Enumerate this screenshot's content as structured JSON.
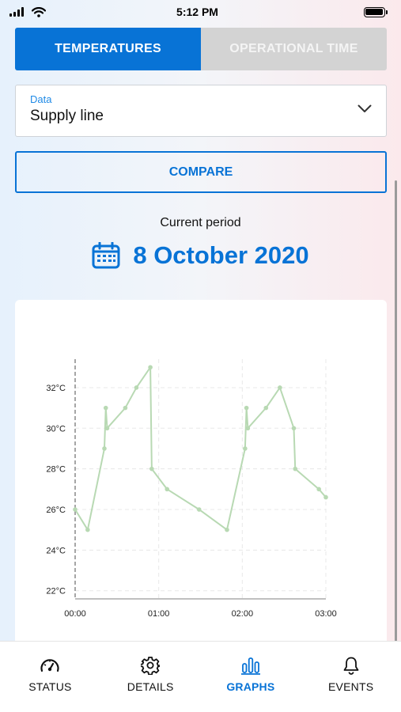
{
  "status_bar": {
    "time": "5:12 PM"
  },
  "tabs": [
    {
      "label": "TEMPERATURES",
      "active": true
    },
    {
      "label": "OPERATIONAL TIME",
      "active": false
    }
  ],
  "data_select": {
    "label": "Data",
    "value": "Supply line"
  },
  "compare_button": {
    "label": "COMPARE"
  },
  "period": {
    "label": "Current period",
    "date": "8 October 2020"
  },
  "chart_data": {
    "type": "line",
    "title": "",
    "xlabel": "",
    "ylabel": "",
    "x_ticks": [
      "00:00",
      "01:00",
      "02:00",
      "03:00"
    ],
    "y_ticks": [
      "22°C",
      "24°C",
      "26°C",
      "28°C",
      "30°C",
      "32°C"
    ],
    "xlim": [
      "00:00",
      "03:00"
    ],
    "ylim": [
      21.6,
      33.4
    ],
    "grid": true,
    "color": "#b8d9b3",
    "series": [
      {
        "values": [
          {
            "x": "00:00",
            "y": 26
          },
          {
            "x": "00:09",
            "y": 25
          },
          {
            "x": "00:21",
            "y": 29
          },
          {
            "x": "00:22",
            "y": 31
          },
          {
            "x": "00:23",
            "y": 30
          },
          {
            "x": "00:36",
            "y": 31
          },
          {
            "x": "00:44",
            "y": 32
          },
          {
            "x": "00:54",
            "y": 33
          },
          {
            "x": "00:55",
            "y": 28
          },
          {
            "x": "01:06",
            "y": 27
          },
          {
            "x": "01:29",
            "y": 26
          },
          {
            "x": "01:49",
            "y": 25
          },
          {
            "x": "02:02",
            "y": 29
          },
          {
            "x": "02:03",
            "y": 31
          },
          {
            "x": "02:04",
            "y": 30
          },
          {
            "x": "02:17",
            "y": 31
          },
          {
            "x": "02:27",
            "y": 32
          },
          {
            "x": "02:37",
            "y": 30
          },
          {
            "x": "02:38",
            "y": 28
          },
          {
            "x": "02:55",
            "y": 27
          },
          {
            "x": "03:00",
            "y": 26.6
          }
        ]
      }
    ]
  },
  "bottom_nav": [
    {
      "label": "STATUS",
      "icon": "gauge-icon",
      "active": false
    },
    {
      "label": "DETAILS",
      "icon": "gear-icon",
      "active": false
    },
    {
      "label": "GRAPHS",
      "icon": "bar-chart-icon",
      "active": true
    },
    {
      "label": "EVENTS",
      "icon": "bell-icon",
      "active": false
    }
  ],
  "colors": {
    "primary": "#0873d6",
    "inactive_tab": "#d3d3d3",
    "chart_line": "#b8d9b3"
  }
}
